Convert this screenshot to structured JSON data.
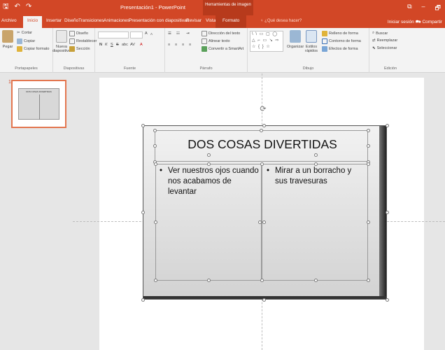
{
  "titlebar": {
    "doc_title": "Presentación1 - PowerPoint",
    "context_title": "Herramientas de imagen",
    "qat_save": "🖫",
    "qat_undo": "↶",
    "qat_redo": "↷",
    "win_restore": "⧉",
    "win_min": "–",
    "win_max": "🗗"
  },
  "tabs": [
    {
      "label": "Archivo"
    },
    {
      "label": "Inicio"
    },
    {
      "label": "Insertar"
    },
    {
      "label": "Diseño"
    },
    {
      "label": "Transiciones"
    },
    {
      "label": "Animaciones"
    },
    {
      "label": "Presentación con diapositivas"
    },
    {
      "label": "Revisar"
    },
    {
      "label": "Vista"
    },
    {
      "label": "Formato"
    }
  ],
  "tellme": "♀ ¿Qué desea hacer?",
  "signin": "Iniciar sesión  🗪 Compartir",
  "ribbon": {
    "clipboard": {
      "paste": "Pegar",
      "cut": "Cortar",
      "copy": "Copiar",
      "format_painter": "Copiar formato",
      "label": "Portapapeles"
    },
    "slides": {
      "new_slide": "Nueva diapositiva",
      "layout": "Diseño",
      "reset": "Restablecer",
      "section": "Sección",
      "label": "Diapositivas"
    },
    "font": {
      "label": "Fuente",
      "bold": "N",
      "italic": "K",
      "underline": "S",
      "strike": "S",
      "shadow": "abc",
      "spacing": "AV",
      "size_up": "A",
      "size_down": "A"
    },
    "paragraph": {
      "label": "Párrafo",
      "text_direction": "Dirección del texto",
      "align_text": "Alinear texto",
      "smartart": "Convertir a SmartArt"
    },
    "drawing": {
      "label": "Dibujo",
      "gallery": "\\ \\ ▭ ▢ ◯ △ ⌐ ▭ ↘ ⇨ ☆ { } ☆",
      "arrange": "Organizar",
      "quick_styles": "Estilos rápidos",
      "fill": "Relleno de forma",
      "outline": "Contorno de forma",
      "effects": "Efectos de forma"
    },
    "editing": {
      "label": "Edición",
      "find": "Buscar",
      "replace": "Reemplazar",
      "select": "Seleccionar"
    }
  },
  "thumbnail": {
    "number": "1",
    "title": "DOS COSAS DIVERTIDAS"
  },
  "slide": {
    "title": "DOS COSAS DIVERTIDAS",
    "left_bullet": "Ver nuestros ojos cuando nos acabamos de levantar",
    "right_bullet": "Mirar a un borracho y sus travesuras",
    "bullet_char": "•"
  },
  "colors": {
    "accent": "#d24726",
    "ribbon_bg": "#f3f3f3",
    "workspace_bg": "#e6e6e6"
  }
}
